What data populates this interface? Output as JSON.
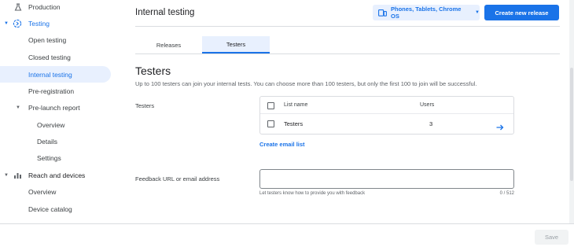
{
  "sidebar": {
    "items": [
      {
        "label": "Production"
      },
      {
        "label": "Testing"
      },
      {
        "label": "Open testing"
      },
      {
        "label": "Closed testing"
      },
      {
        "label": "Internal testing"
      },
      {
        "label": "Pre-registration"
      },
      {
        "label": "Pre-launch report"
      },
      {
        "label": "Overview"
      },
      {
        "label": "Details"
      },
      {
        "label": "Settings"
      },
      {
        "label": "Reach and devices"
      },
      {
        "label": "Overview"
      },
      {
        "label": "Device catalog"
      }
    ]
  },
  "header": {
    "title": "Internal testing",
    "device_filter": "Phones, Tablets, Chrome OS",
    "create_release": "Create new release"
  },
  "tabs": [
    {
      "label": "Releases"
    },
    {
      "label": "Testers"
    }
  ],
  "testers_section": {
    "title": "Testers",
    "description": "Up to 100 testers can join your internal tests. You can choose more than 100 testers, but only the first 100 to join will be successful.",
    "field_label": "Testers",
    "table": {
      "columns": [
        "List name",
        "Users"
      ],
      "rows": [
        {
          "name": "Testers",
          "users": "3"
        }
      ]
    },
    "create_email_list": "Create email list"
  },
  "feedback": {
    "label": "Feedback URL or email address",
    "value": "",
    "helper": "Let testers know how to provide you with feedback",
    "counter": "0 / 512"
  },
  "footer": {
    "save": "Save"
  },
  "colors": {
    "accent": "#1a73e8",
    "active_bg": "#e8f0fe"
  }
}
